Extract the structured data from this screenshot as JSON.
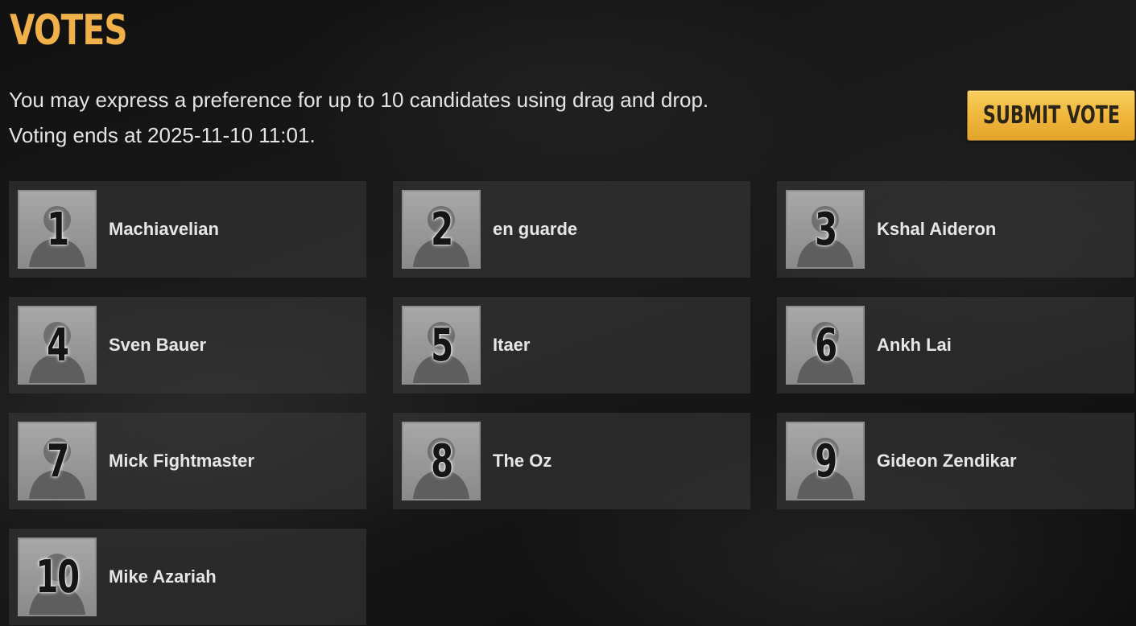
{
  "page": {
    "title": "VOTES",
    "intro_line1": "You may express a preference for up to 10 candidates using drag and drop.",
    "intro_line2": "Voting ends at 2025-11-10 11:01."
  },
  "submit": {
    "label": "SUBMIT VOTE"
  },
  "colors": {
    "accent": "#f0b04a",
    "button": "#efb53a",
    "card": "#3a3a3a"
  },
  "candidates": [
    {
      "rank": "1",
      "name": "Machiavelian",
      "avatar": "portrait-icon"
    },
    {
      "rank": "2",
      "name": "en guarde",
      "avatar": "portrait-icon"
    },
    {
      "rank": "3",
      "name": "Kshal Aideron",
      "avatar": "portrait-icon"
    },
    {
      "rank": "4",
      "name": "Sven Bauer",
      "avatar": "portrait-icon"
    },
    {
      "rank": "5",
      "name": "Itaer",
      "avatar": "portrait-icon"
    },
    {
      "rank": "6",
      "name": "Ankh Lai",
      "avatar": "portrait-icon"
    },
    {
      "rank": "7",
      "name": "Mick Fightmaster",
      "avatar": "portrait-icon"
    },
    {
      "rank": "8",
      "name": "The Oz",
      "avatar": "portrait-icon"
    },
    {
      "rank": "9",
      "name": "Gideon Zendikar",
      "avatar": "portrait-icon"
    },
    {
      "rank": "10",
      "name": "Mike Azariah",
      "avatar": "portrait-icon"
    }
  ]
}
